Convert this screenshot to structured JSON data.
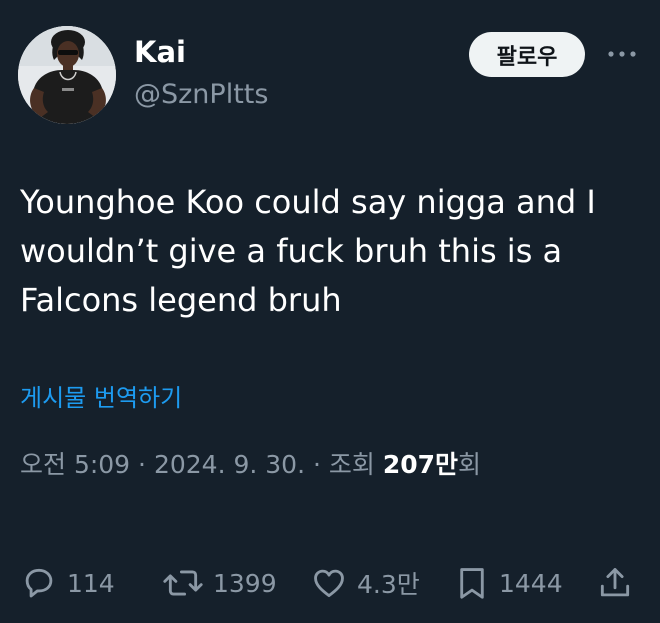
{
  "author": {
    "display_name": "Kai",
    "handle": "@SznPltts"
  },
  "header": {
    "follow_label": "팔로우",
    "more_icon": "more-horizontal-icon"
  },
  "tweet": {
    "text": "Younghoe Koo could say nigga and I\nwouldn’t give a fuck bruh this is a\nFalcons legend bruh",
    "translate_label": "게시물 번역하기"
  },
  "meta": {
    "time": "오전 5:09",
    "separator": "·",
    "date": "2024. 9. 30.",
    "views_label": "조회",
    "views_count": "207만",
    "views_unit": "회"
  },
  "actions": {
    "replies": "114",
    "reposts": "1399",
    "likes": "4.3만",
    "bookmarks": "1444"
  },
  "colors": {
    "background": "#15202b",
    "text_primary": "#ffffff",
    "text_secondary": "#8b98a5",
    "link": "#1d9bf0",
    "button_bg": "#eff3f4"
  }
}
